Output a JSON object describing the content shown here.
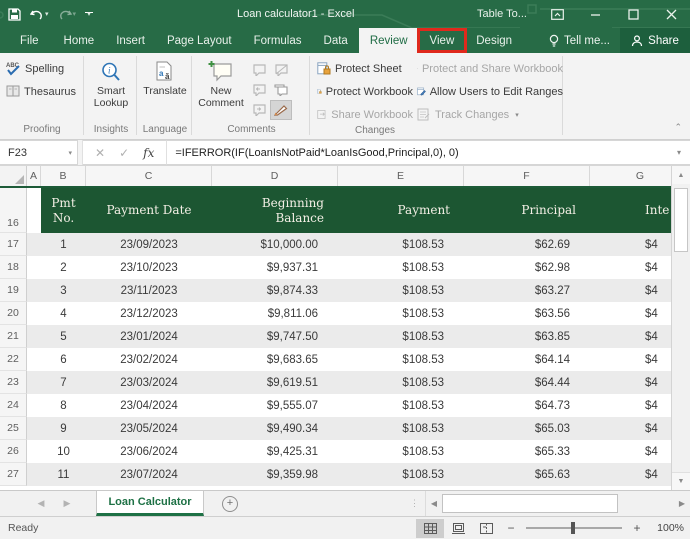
{
  "window": {
    "title": "Loan calculator1 - Excel",
    "context_group": "Table To..."
  },
  "tabs": {
    "items": [
      {
        "label": "File"
      },
      {
        "label": "Home"
      },
      {
        "label": "Insert"
      },
      {
        "label": "Page Layout"
      },
      {
        "label": "Formulas"
      },
      {
        "label": "Data"
      },
      {
        "label": "Review"
      },
      {
        "label": "View"
      },
      {
        "label": "Design"
      }
    ],
    "tell_me": "Tell me...",
    "share": "Share"
  },
  "ribbon": {
    "proofing": {
      "label": "Proofing",
      "spelling": "Spelling",
      "thesaurus": "Thesaurus"
    },
    "insights": {
      "label": "Insights",
      "smart_lookup": "Smart Lookup"
    },
    "language": {
      "label": "Language",
      "translate": "Translate"
    },
    "comments": {
      "label": "Comments",
      "new_comment": "New Comment"
    },
    "changes": {
      "label": "Changes",
      "protect_sheet": "Protect Sheet",
      "protect_workbook": "Protect Workbook",
      "share_workbook": "Share Workbook",
      "protect_and_share": "Protect and Share Workbook",
      "allow_users": "Allow Users to Edit Ranges",
      "track_changes": "Track Changes"
    }
  },
  "formula_bar": {
    "name_box": "F23",
    "formula": "=IFERROR(IF(LoanIsNotPaid*LoanIsGood,Principal,0), 0)"
  },
  "grid": {
    "column_letters": [
      "A",
      "B",
      "C",
      "D",
      "E",
      "F",
      "G"
    ],
    "row_numbers": [
      16,
      17,
      18,
      19,
      20,
      21,
      22,
      23,
      24,
      25,
      26,
      27
    ]
  },
  "table": {
    "header": {
      "pmt_no": "Pmt\nNo.",
      "payment_date": "Payment Date",
      "beginning_balance": "Beginning\nBalance",
      "payment": "Payment",
      "principal": "Principal",
      "interest_clipped": "Inte"
    },
    "rows": [
      {
        "pmt": "1",
        "date": "23/09/2023",
        "balance": "$10,000.00",
        "payment": "$108.53",
        "principal": "$62.69",
        "interest_clipped": "$4"
      },
      {
        "pmt": "2",
        "date": "23/10/2023",
        "balance": "$9,937.31",
        "payment": "$108.53",
        "principal": "$62.98",
        "interest_clipped": "$4"
      },
      {
        "pmt": "3",
        "date": "23/11/2023",
        "balance": "$9,874.33",
        "payment": "$108.53",
        "principal": "$63.27",
        "interest_clipped": "$4"
      },
      {
        "pmt": "4",
        "date": "23/12/2023",
        "balance": "$9,811.06",
        "payment": "$108.53",
        "principal": "$63.56",
        "interest_clipped": "$4"
      },
      {
        "pmt": "5",
        "date": "23/01/2024",
        "balance": "$9,747.50",
        "payment": "$108.53",
        "principal": "$63.85",
        "interest_clipped": "$4"
      },
      {
        "pmt": "6",
        "date": "23/02/2024",
        "balance": "$9,683.65",
        "payment": "$108.53",
        "principal": "$64.14",
        "interest_clipped": "$4"
      },
      {
        "pmt": "7",
        "date": "23/03/2024",
        "balance": "$9,619.51",
        "payment": "$108.53",
        "principal": "$64.44",
        "interest_clipped": "$4"
      },
      {
        "pmt": "8",
        "date": "23/04/2024",
        "balance": "$9,555.07",
        "payment": "$108.53",
        "principal": "$64.73",
        "interest_clipped": "$4"
      },
      {
        "pmt": "9",
        "date": "23/05/2024",
        "balance": "$9,490.34",
        "payment": "$108.53",
        "principal": "$65.03",
        "interest_clipped": "$4"
      },
      {
        "pmt": "10",
        "date": "23/06/2024",
        "balance": "$9,425.31",
        "payment": "$108.53",
        "principal": "$65.33",
        "interest_clipped": "$4"
      },
      {
        "pmt": "11",
        "date": "23/07/2024",
        "balance": "$9,359.98",
        "payment": "$108.53",
        "principal": "$65.63",
        "interest_clipped": "$4"
      }
    ]
  },
  "sheet_tabs": {
    "active_tab": "Loan Calculator"
  },
  "status_bar": {
    "status": "Ready",
    "zoom_level": "100%"
  },
  "colors": {
    "excel_green": "#276b46",
    "share_button_green": "#1d5f3d",
    "table_header_green": "#1c5632",
    "active_tab_text_green": "#1e6b44",
    "annotation_red": "#df291c",
    "banded_row_gray": "#ebebeb"
  }
}
